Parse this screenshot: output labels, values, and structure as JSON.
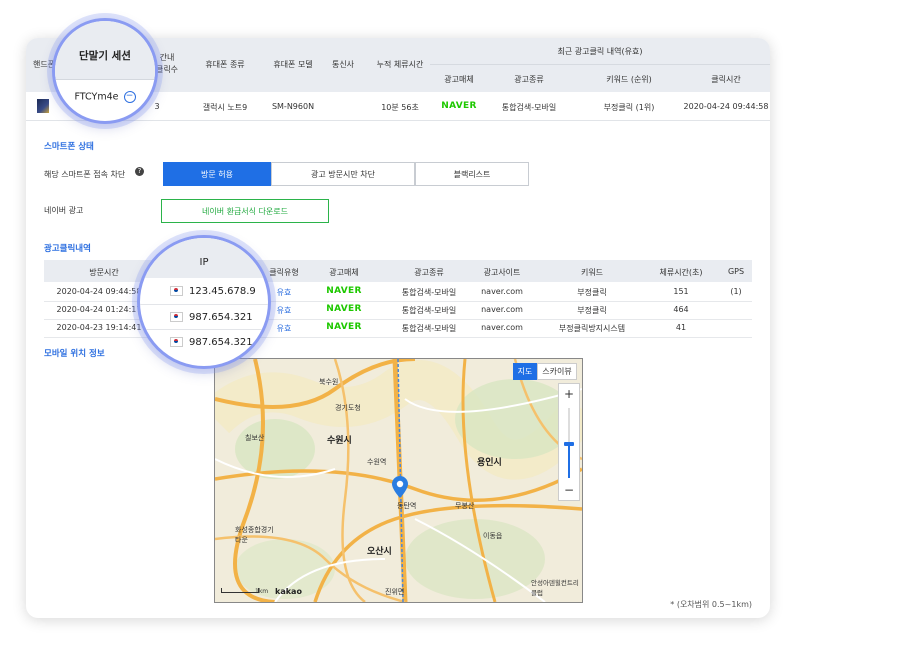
{
  "top_table": {
    "headers": {
      "handphone": "핸드폰",
      "clicks_line1": "간내",
      "clicks_line2": "클릭수",
      "phone_type": "휴대폰 종류",
      "phone_model": "휴대폰 모델",
      "carrier": "통신사",
      "total_stay": "누적 체류시간",
      "recent_group": "최근 광고클릭 내역(유효)",
      "ad_media": "광고매체",
      "ad_type": "광고종류",
      "keyword_rank": "키워드 (순위)",
      "click_time": "클릭시간"
    },
    "row": {
      "clicks": "3",
      "phone_type": "갤럭시 노트9",
      "phone_model": "SM-N960N",
      "total_stay": "10분 56초",
      "ad_media": "NAVER",
      "ad_type": "통합검색-모바일",
      "keyword_rank": "부정클릭 (1위)",
      "click_time": "2020-04-24 09:44:58"
    }
  },
  "session_circle": {
    "title": "단말기 세션",
    "session_id": "FTCYm4e"
  },
  "smartphone_status": {
    "section_title": "스마트폰 상태",
    "block_label": "해당 스마트폰 접속 차단",
    "options": [
      "방문 허용",
      "광고 방문시만 차단",
      "블랙리스트"
    ],
    "selected": "방문 허용",
    "naver_label": "네이버 광고",
    "download_button": "네이버 환급서식 다운로드"
  },
  "ad_click_history": {
    "section_title": "광고클릭내역",
    "headers": [
      "방문시간",
      "IP",
      "클릭유형",
      "광고매체",
      "광고종류",
      "광고사이트",
      "키워드",
      "체류시간(초)",
      "GPS"
    ],
    "rows": [
      {
        "time": "2020-04-24 09:44:58",
        "ip": "123.45.678.9",
        "click_type": "유효",
        "media": "NAVER",
        "ad_type": "통합검색-모바일",
        "site": "naver.com",
        "keyword": "부정클릭",
        "stay": "151",
        "gps": "(1)"
      },
      {
        "time": "2020-04-24 01:24:17",
        "ip": "987.654.321",
        "click_type": "유효",
        "media": "NAVER",
        "ad_type": "통합검색-모바일",
        "site": "naver.com",
        "keyword": "부정클릭",
        "stay": "464",
        "gps": ""
      },
      {
        "time": "2020-04-23 19:14:41",
        "ip": "987.654.321",
        "click_type": "유효",
        "media": "NAVER",
        "ad_type": "통합검색-모바일",
        "site": "naver.com",
        "keyword": "부정클릭방지시스템",
        "stay": "41",
        "gps": ""
      }
    ]
  },
  "ip_circle": {
    "title": "IP",
    "ips": [
      "123.45.678.9",
      "987.654.321",
      "987.654.321"
    ]
  },
  "mobile_location": {
    "section_title": "모바일 위치 정보",
    "map_type_map": "지도",
    "map_type_sky": "스카이뷰",
    "zoom_in": "+",
    "zoom_out": "−",
    "scale_label": "1km",
    "brand": "kakao",
    "places": {
      "suwon": "수원시",
      "yongin": "용인시",
      "osan": "오산시",
      "dongtan": "동탄역",
      "suwon_station": "수원역",
      "gyeonggi": "경기도청",
      "hwaseong": "화성종합경기타운",
      "cheonggyesan": "칠보산",
      "anseong": "안성아덴힐컨트리클럽",
      "boknae": "북수원",
      "ieum": "이동읍",
      "musan": "무봉산",
      "jinwi": "진위면"
    },
    "error_note": "* (오차범위 0.5~1km)"
  },
  "colors": {
    "accent_blue": "#1f6fe5",
    "naver_green": "#1ec800",
    "circle_border": "#8a9bf2"
  }
}
